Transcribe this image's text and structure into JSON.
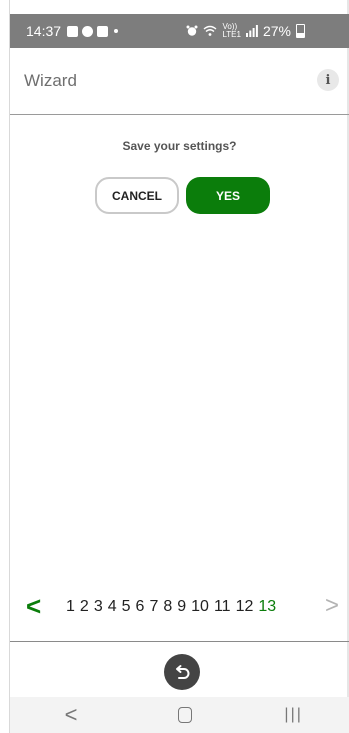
{
  "status_bar": {
    "time": "14:37",
    "icons_left": [
      "gallery-icon",
      "messenger-icon",
      "outlook-icon"
    ],
    "icons_right": [
      "alarm-icon",
      "wifi-icon",
      "volte-icon",
      "signal-icon"
    ],
    "volte_text": "Vo))\nLTE1",
    "battery": "27%"
  },
  "app_bar": {
    "title": "Wizard",
    "info_label": "i"
  },
  "dialog": {
    "question": "Save your settings?",
    "cancel_label": "CANCEL",
    "yes_label": "YES"
  },
  "pager": {
    "prev": "<",
    "next": ">",
    "pages": [
      "1",
      "2",
      "3",
      "4",
      "5",
      "6",
      "7",
      "8",
      "9",
      "10",
      "11",
      "12",
      "13"
    ],
    "current": "13"
  },
  "nav_bar": {
    "back": "<",
    "recent": "|||"
  },
  "colors": {
    "accent": "#0b7d0b",
    "status_bar": "#7d7d7d"
  }
}
